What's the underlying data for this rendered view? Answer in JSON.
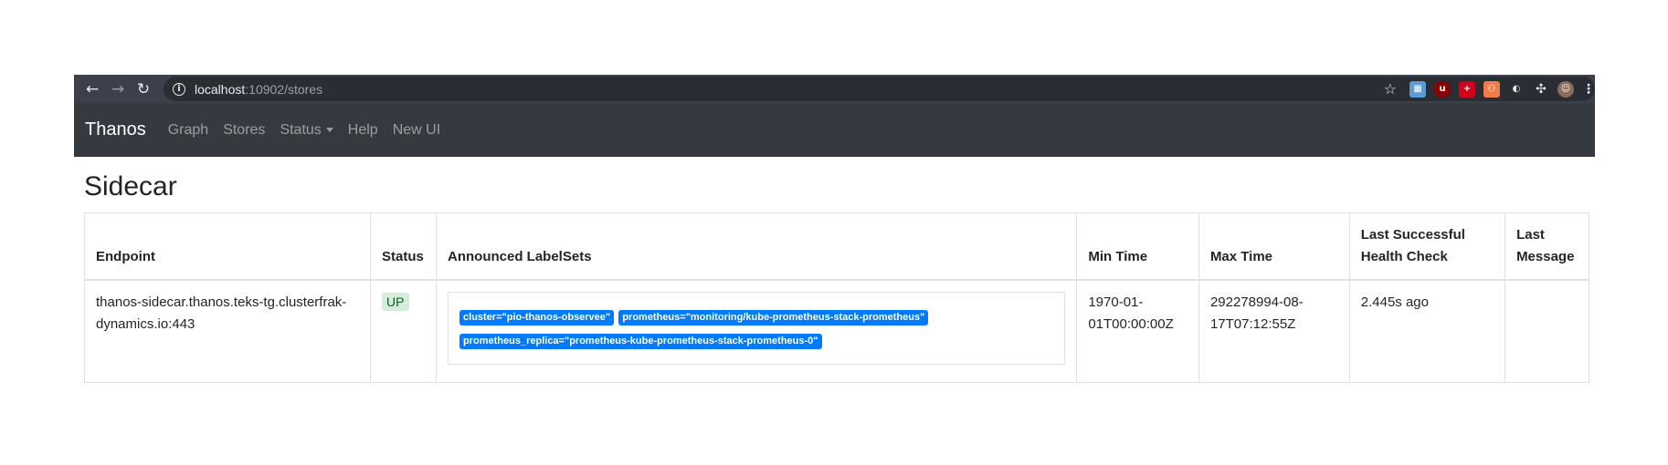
{
  "browser": {
    "url_host": "localhost",
    "url_rest": ":10902/stores",
    "extensions": [
      "calendar-ext-icon",
      "ublock-icon",
      "plus-ext-icon",
      "org-ext-icon",
      "ext5-icon",
      "puzzle-icon",
      "profile-avatar",
      "menu-kebab-icon"
    ]
  },
  "navbar": {
    "brand": "Thanos",
    "links": [
      "Graph",
      "Stores",
      "Status",
      "Help",
      "New UI"
    ]
  },
  "page": {
    "title": "Sidecar"
  },
  "table": {
    "headers": [
      "Endpoint",
      "Status",
      "Announced LabelSets",
      "Min Time",
      "Max Time",
      "Last Successful Health Check",
      "Last Message"
    ],
    "rows": [
      {
        "endpoint": "thanos-sidecar.thanos.teks-tg.clusterfrak-dynamics.io:443",
        "status": "UP",
        "labels": [
          "cluster=\"pio-thanos-observee\"",
          "prometheus=\"monitoring/kube-prometheus-stack-prometheus\"",
          "prometheus_replica=\"prometheus-kube-prometheus-stack-prometheus-0\""
        ],
        "min_time": "1970-01-01T00:00:00Z",
        "max_time": "292278994-08-17T07:12:55Z",
        "last_health_check": "2.445s ago",
        "last_message": ""
      }
    ]
  },
  "colors": {
    "navbar_bg": "#343a40",
    "chrome_bg": "#3c404a",
    "label_badge": "#007bff",
    "status_up_bg": "#d4edda"
  }
}
